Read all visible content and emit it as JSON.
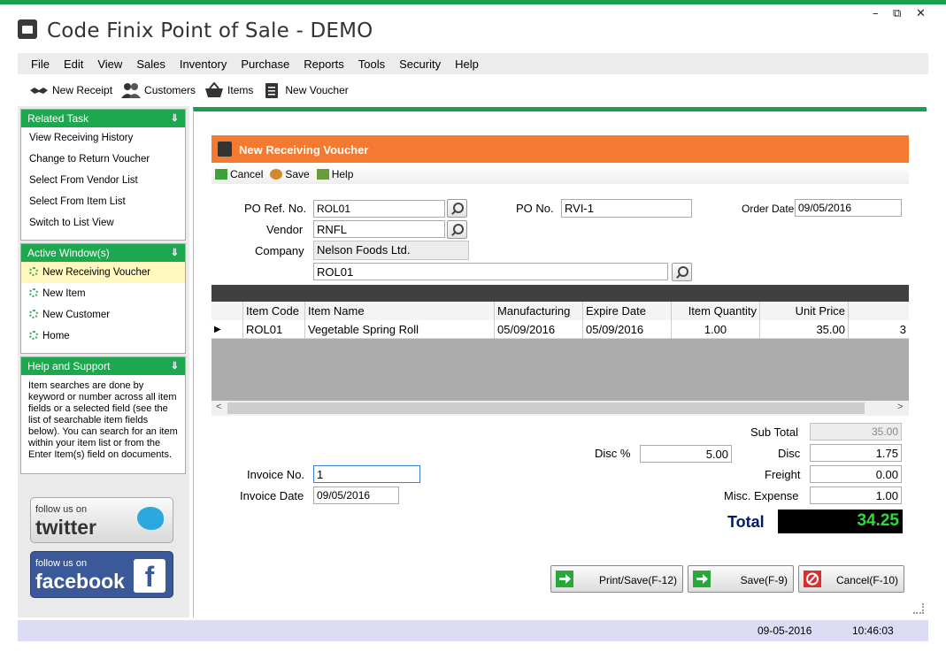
{
  "window": {
    "title": "Code Finix Point of Sale - DEMO",
    "controls": {
      "minimize": "–",
      "restore": "⧉",
      "close": "✕"
    }
  },
  "menu": [
    "File",
    "Edit",
    "View",
    "Sales",
    "Inventory",
    "Purchase",
    "Reports",
    "Tools",
    "Security",
    "Help"
  ],
  "toolbar": [
    {
      "label": "New Receipt",
      "icon": "handshake-icon"
    },
    {
      "label": "Customers",
      "icon": "customers-icon"
    },
    {
      "label": "Items",
      "icon": "basket-icon"
    },
    {
      "label": "New Voucher",
      "icon": "clipboard-icon"
    }
  ],
  "sidebar": {
    "related_task": {
      "title": "Related Task",
      "items": [
        "View Receiving History",
        "Change to Return Voucher",
        "Select From Vendor List",
        "Select From Item List",
        "Switch to List View"
      ]
    },
    "active_windows": {
      "title": "Active Window(s)",
      "items": [
        "New Receiving Voucher",
        "New Item",
        "New Customer",
        "Home"
      ]
    },
    "help": {
      "title": "Help and Support",
      "text": "Item searches are done by keyword or number across all item fields or a selected field (see the list of searchable item fields below). You can search for an item within your item list or from the Enter Item(s) field on documents."
    },
    "twitter": {
      "line1": "follow us on",
      "line2": "twitter"
    },
    "facebook": {
      "line1": "follow us on",
      "line2": "facebook",
      "glyph": "f"
    }
  },
  "voucher": {
    "title": "New Receiving Voucher",
    "actions": [
      "Cancel",
      "Save",
      "Help"
    ],
    "po_ref_label": "PO Ref. No.",
    "po_ref": "ROL01",
    "po_no_label": "PO No.",
    "po_no": "RVI-1",
    "order_date_label": "Order Date",
    "order_date": "09/05/2016",
    "vendor_label": "Vendor",
    "vendor": "RNFL",
    "company_label": "Company",
    "company": "Nelson Foods Ltd.",
    "item_search": "ROL01"
  },
  "grid": {
    "columns": [
      "Item Code",
      "Item Name",
      "Manufacturing",
      "Expire Date",
      "Item Quantity",
      "Unit Price"
    ],
    "rows": [
      [
        "ROL01",
        "Vegetable Spring Roll",
        "05/09/2016",
        "05/09/2016",
        "1.00",
        "35.00"
      ]
    ],
    "row_marker": "▶",
    "overflow_cell": "3",
    "scroll_left": "<",
    "scroll_right": ">"
  },
  "footer": {
    "invoice_no_label": "Invoice No.",
    "invoice_no": "1",
    "invoice_date_label": "Invoice Date",
    "invoice_date": "09/05/2016",
    "disc_pct_label": "Disc %",
    "disc_pct": "5.00",
    "subtotal_label": "Sub Total",
    "subtotal": "35.00",
    "disc_label": "Disc",
    "disc": "1.75",
    "freight_label": "Freight",
    "freight": "0.00",
    "misc_label": "Misc. Expense",
    "misc": "1.00",
    "total_label": "Total",
    "total": "34.25"
  },
  "buttons": {
    "print_save": "Print/Save(F-12)",
    "save": "Save(F-9)",
    "cancel": "Cancel(F-10)"
  },
  "colors": {
    "accent_green": "#1aa04a",
    "header_orange": "#f47a31",
    "total_green": "#29e02f"
  },
  "status": {
    "date": "09-05-2016",
    "time": "10:46:03"
  }
}
